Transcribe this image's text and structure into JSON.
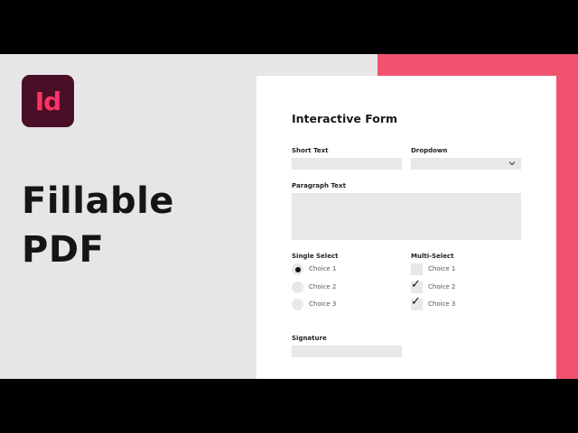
{
  "logo": {
    "text": "Id",
    "icon": "indesign-logo-icon"
  },
  "headline": {
    "line1": "Fillable",
    "line2": "PDF"
  },
  "form": {
    "title": "Interactive Form",
    "short_text_label": "Short Text",
    "dropdown_label": "Dropdown",
    "dropdown_icon": "chevron-down-icon",
    "paragraph_label": "Paragraph Text",
    "single_select_label": "Single Select",
    "multi_select_label": "Multi-Select",
    "single_options": [
      {
        "label": "Choice 1",
        "selected": true
      },
      {
        "label": "Choice 2",
        "selected": false
      },
      {
        "label": "Choice 3",
        "selected": false
      }
    ],
    "multi_options": [
      {
        "label": "Choice 1",
        "checked": false
      },
      {
        "label": "Choice 2",
        "checked": true
      },
      {
        "label": "Choice 3",
        "checked": true
      }
    ],
    "check_glyph": "✓",
    "signature_label": "Signature"
  },
  "colors": {
    "accent": "#f05270",
    "logo_bg": "#4a0e26",
    "logo_text": "#ff3366",
    "stage_bg": "#e6e6e6",
    "field_bg": "#e7e8e9"
  }
}
